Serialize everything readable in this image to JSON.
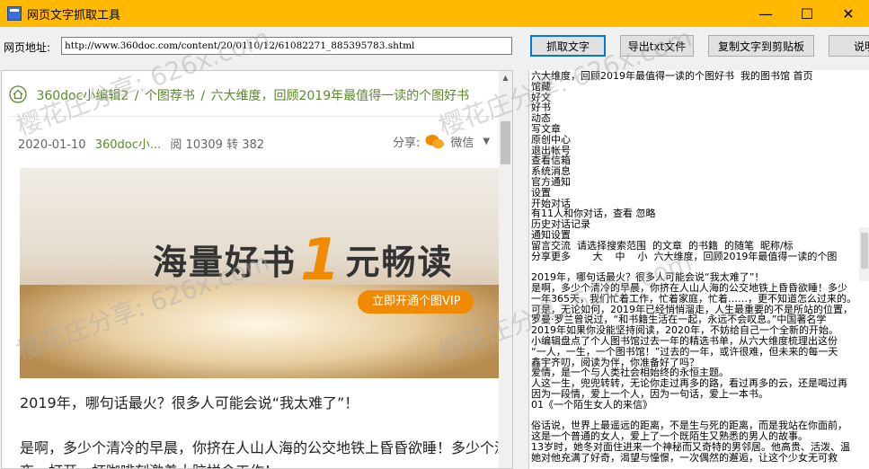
{
  "window": {
    "title": "网页文字抓取工具",
    "controls": [
      "—",
      "☐",
      "✕"
    ]
  },
  "toolbar": {
    "address_label": "网页地址:",
    "url": "http://www.360doc.com/content/20/0110/12/61082271_885395783.shtml",
    "grab_label": "抓取文字",
    "export_label": "导出txt文件",
    "copy_label": "复制文字到剪贴板",
    "more_label": "说明"
  },
  "browser": {
    "breadcrumb": [
      "360doc小编辑2",
      "个图荐书",
      "六大维度，回顾2019年最值得一读的个图好书"
    ],
    "breadcrumb_sep": "/",
    "date": "2020-01-10",
    "author": "360doc小...",
    "reads": "阅 10309",
    "reposts": "转 382",
    "share_label": "分享:",
    "share_target": "微信",
    "banner_text_a": "海量好书",
    "banner_text_num": "1",
    "banner_text_b": "元畅读",
    "banner_button": "立即开通个图VIP",
    "para1": "2019年，哪句话最火？很多人可能会说“我太难了”！",
    "para2": "是啊，多少个清冷的早晨，你挤在人山人海的公交地铁上昏昏欲睡！多少个深",
    "para3": "夜，打开一杯咖啡刻激着大脑拼命工作！"
  },
  "extracted_text": [
    "六大维度，回顾2019年最值得一读的个图好书  我的图书馆 首页",
    "馆藏",
    "好文",
    "好书",
    "动态",
    "写文章",
    "原创中心",
    "退出帐号",
    "查看信箱",
    "系统消息",
    "官方通知",
    "设置",
    "开始对话",
    "有11人和你对话，查看 忽略",
    "历史对话记录",
    "通知设置",
    "留言交流  请选择搜索范围  的文章  的书籍  的随笔  昵称/标",
    "分享更多       大    中    小  六大维度，回顾2019年最值得一读的个图",
    "",
    "2019年，哪句话最火？很多人可能会说“我太难了”！",
    "是啊，多少个清冷的早晨，你挤在人山人海的公交地铁上昏昏欲睡！多少",
    "一年365天，我们忙着工作，忙着家庭，忙着……，更不知道怎么过来的。",
    "可是，无论如何，2019年已经悄悄溜走，人生最重要的不是所站的位置，",
    "罗曼·罗兰曾说过，“和书籍生活在一起，永远不会叹息。”中国著名学",
    "2019年如果你没能坚持阅读，2020年，不妨给自己一个全新的开始。",
    "小编辑盘点了个人图书馆过去一年的精选书单，从六大维度梳理出这份",
    "“一人，一生，一个图书馆！”过去的一年，或许很难，但未来的每一天",
    "鑫宇齐叨，阅读为伴，你准备好了吗？",
    "爱情，是一个与人类社会相始终的永恒主题。",
    "人这一生，兜兜转转，无论你走过再多的路，看过再多的云，还是喝过再",
    "因为一段情，爱上一个人，因为一句话，爱上一本书。",
    "01《一个陌生女人的来信》",
    "",
    "俗话说，世界上最遥远的距离，不是生与死的距离，而是我站在你面前，",
    "这是一个普通的女人，爱上了一个既陌生又熟悉的男人的故事。",
    "13岁时，她冬对面住进来一个神秘而又奇特的男邻居。他高贵、活泼、温",
    "她对他充满了好奇，渴望与憧憬，一次偶然的邂逅，让这个少女无可救"
  ],
  "watermark_text": "樱花庄分享: 626x.com",
  "colors": {
    "titlebar": "#ffb900",
    "link_green": "#5a8a2a",
    "banner_orange": "#f08a00"
  }
}
